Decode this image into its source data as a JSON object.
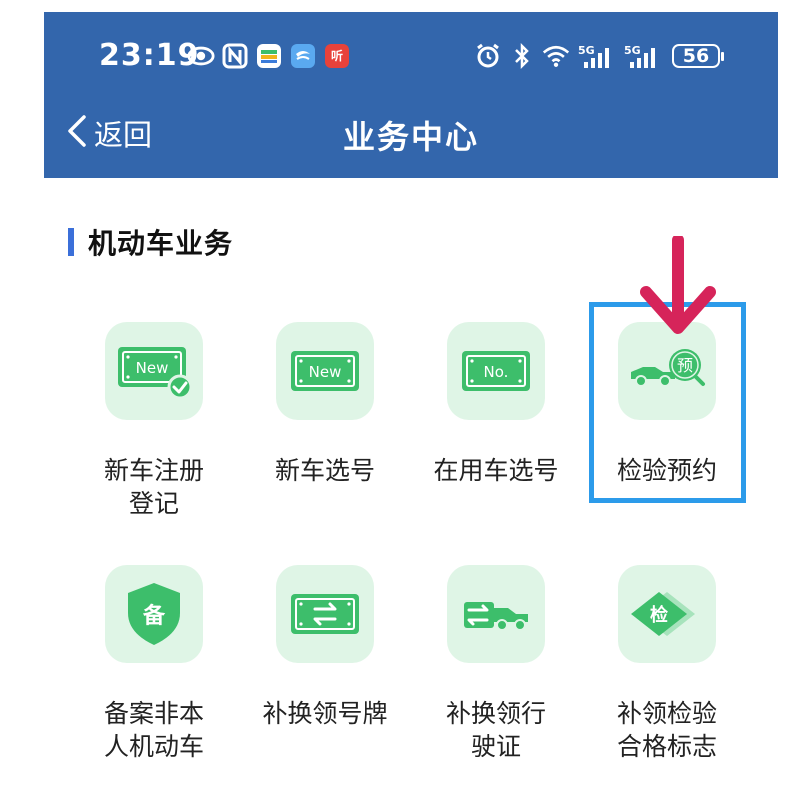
{
  "status_bar": {
    "time": "23:19",
    "battery": "56",
    "signal_label_1": "5G",
    "signal_label_2": "5G"
  },
  "header": {
    "back_label": "返回",
    "title": "业务中心"
  },
  "section": {
    "title": "机动车业务"
  },
  "items": [
    {
      "label": "新车注册\n登记",
      "icon_text": "New"
    },
    {
      "label": "新车选号",
      "icon_text": "New"
    },
    {
      "label": "在用车选号",
      "icon_text": "No."
    },
    {
      "label": "检验预约",
      "icon_text": "预"
    },
    {
      "label": "备案非本\n人机动车",
      "icon_text": "备"
    },
    {
      "label": "补换领号牌",
      "icon_text": ""
    },
    {
      "label": "补换领行\n驶证",
      "icon_text": ""
    },
    {
      "label": "补领检验\n合格标志",
      "icon_text": "检"
    }
  ],
  "colors": {
    "header_bg": "#3366ac",
    "icon_green": "#3dbe6b",
    "tile_bg": "#dff5e6",
    "highlight": "#2c9bea",
    "arrow": "#d6245a"
  }
}
